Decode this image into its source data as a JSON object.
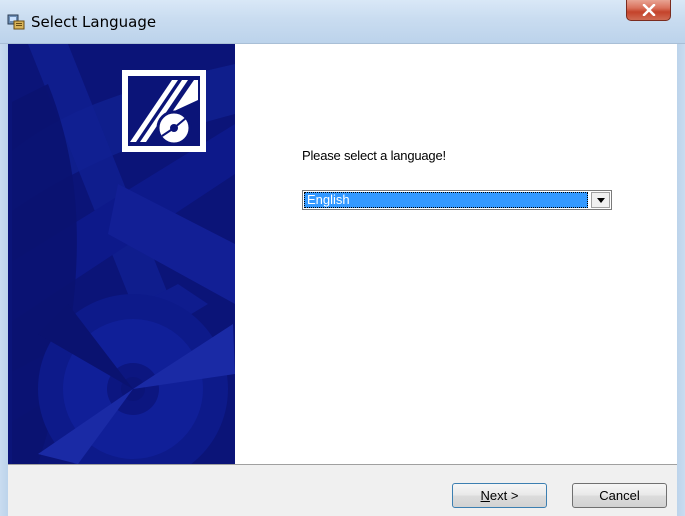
{
  "window": {
    "title": "Select Language"
  },
  "content": {
    "prompt": "Please select a language!",
    "language_select": {
      "selected": "English"
    }
  },
  "buttons": {
    "next_mnemonic": "N",
    "next_rest": "ext >",
    "cancel": "Cancel"
  },
  "colors": {
    "banner": "#0b1478",
    "selection": "#3399ff"
  },
  "icons": {
    "app": "installer-icon",
    "close": "close-icon",
    "dropdown": "chevron-down-icon",
    "logo": "cd-logo-icon"
  }
}
